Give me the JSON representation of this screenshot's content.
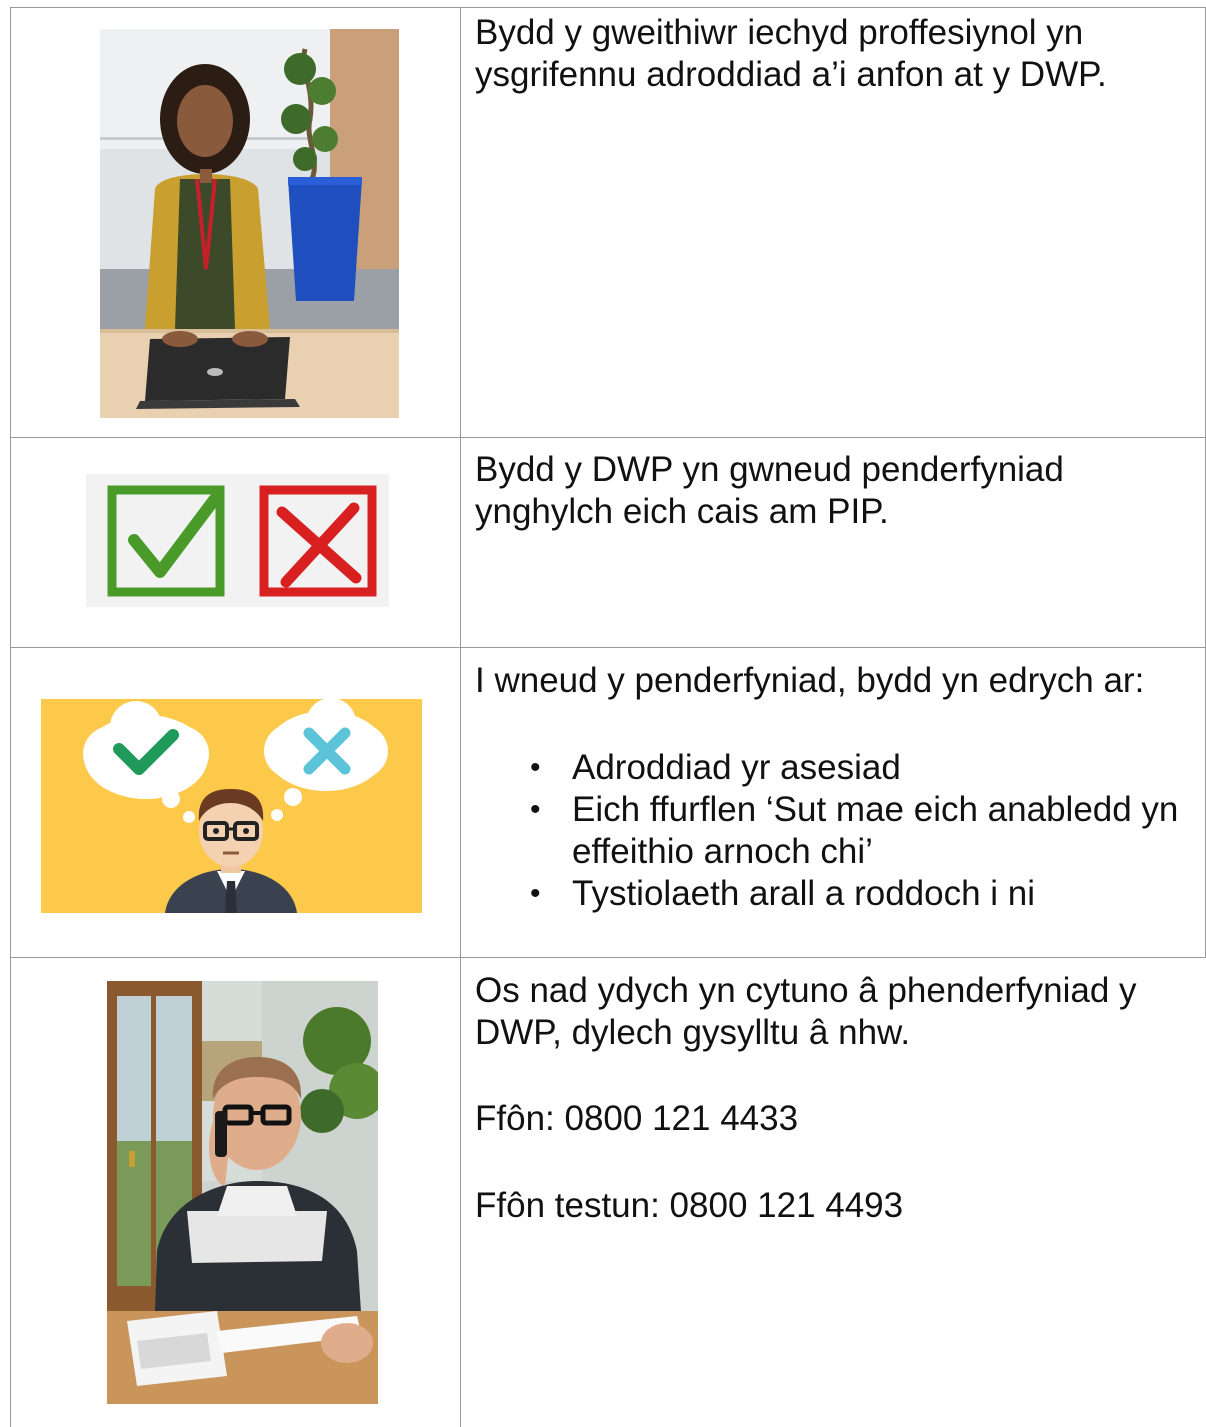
{
  "rows": [
    {
      "image": "person-typing-on-laptop-photo",
      "text": "Bydd y gweithiwr iechyd proffesiynol yn ysgrifennu adroddiad a’i anfon at y DWP."
    },
    {
      "image": "tick-and-cross-boxes-picture",
      "text": "Bydd y DWP yn gwneud penderfyniad ynghylch eich cais am PIP."
    },
    {
      "image": "person-deciding-illustration",
      "intro": "I wneud y penderfyniad, bydd yn edrych ar:",
      "bullets": [
        "Adroddiad yr asesiad",
        "Eich ffurflen ‘Sut mae eich anabledd yn effeithio arnoch chi’",
        "Tystiolaeth arall a roddoch i ni"
      ]
    },
    {
      "image": "person-on-phone-reading-letter-photo",
      "text": "Os nad ydych yn cytuno â phenderfyniad y DWP, dylech gysylltu â nhw.",
      "phone": "Ffôn: 0800 121 4433",
      "textphone": "Ffôn testun: 0800 121 4493"
    }
  ],
  "colors": {
    "tick_green": "#4a9a2a",
    "cross_red": "#d82020",
    "illustration_bg": "#fcc94a",
    "border": "#9a9a9a"
  }
}
